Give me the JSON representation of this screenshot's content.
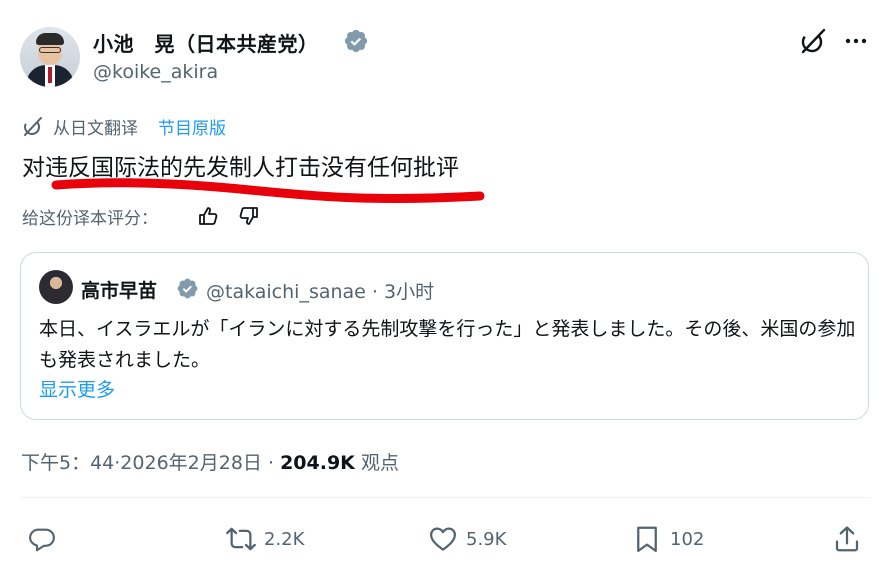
{
  "author": {
    "name": "小池　晃（日本共産党）",
    "handle": "@koike_akira"
  },
  "translation": {
    "label": "从日文翻译",
    "original_link": "节目原版"
  },
  "tweet_text": "对违反国际法的先发制人打击没有任何批评",
  "rate_label": "给这份译本评分：",
  "quote": {
    "name": "高市早苗",
    "handle": "@takaichi_sanae",
    "separator": "·",
    "time": "3小时",
    "text": "本日、イスラエルが「イランに対する先制攻撃を行った」と発表しました。その後、米国の参加も発表されました。",
    "show_more": "显示更多"
  },
  "meta": {
    "time": "下午5：44",
    "date": "·2026年2月28日",
    "separator": " · ",
    "views": "204.9K",
    "views_label": "观点"
  },
  "actions": {
    "retweets": "2.2K",
    "likes": "5.9K",
    "bookmarks": "102"
  },
  "icons": {
    "verified": "verified-badge-icon",
    "grok": "grok-icon",
    "more": "more-icon",
    "translate": "translate-icon",
    "reply": "reply-icon",
    "retweet": "retweet-icon",
    "like": "heart-icon",
    "bookmark": "bookmark-icon",
    "share": "share-icon"
  },
  "colors": {
    "accent": "#1d9bf0",
    "secondary_text": "#536471",
    "verified_badge": "#829aab",
    "annotation_red": "#e8000b"
  }
}
